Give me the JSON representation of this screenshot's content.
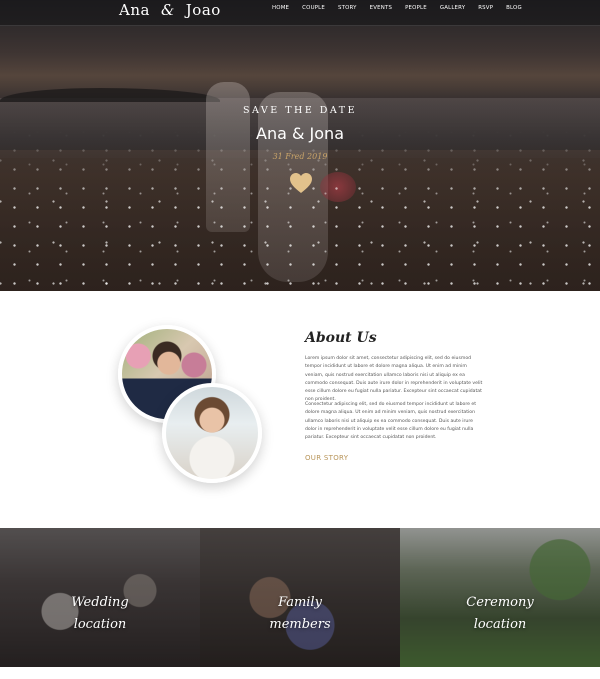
{
  "nav": {
    "logo_first": "Ana",
    "logo_amp": "&",
    "logo_second": "Joao",
    "links": [
      "HOME",
      "COUPLE",
      "STORY",
      "EVENTS",
      "PEOPLE",
      "GALLERY",
      "RSVP",
      "BLOG"
    ]
  },
  "hero": {
    "tagline": "SAVE THE DATE",
    "names": "Ana & Jona",
    "date": "31 Fred 2019",
    "icon": "heart-icon",
    "accent_color": "#c9a469"
  },
  "about": {
    "title": "About Us",
    "paragraph1": "Lorem ipsum dolor sit amet, consectetur adipiscing elit, sed do eiusmod tempor incididunt ut labore et dolore magna aliqua. Ut enim ad minim veniam, quis nostrud exercitation ullamco laboris nisi ut aliquip ex ea commodo consequat. Duis aute irure dolor in reprehenderit in voluptate velit esse cillum dolore eu fugiat nulla pariatur. Excepteur sint occaecat cupidatat non proident.",
    "paragraph2": "Consectetur adipiscing elit, sed do eiusmod tempor incididunt ut labore et dolore magna aliqua. Ut enim ad minim veniam, quis nostrud exercitation ullamco laboris nisi ut aliquip ex ea commodo consequat. Duis aute irure dolor in reprehenderit in voluptate velit esse cillum dolore eu fugiat nulla pariatur. Excepteur sint occaecat cupidatat non proident.",
    "link_label": "OUR STORY",
    "link_color": "#b8955a"
  },
  "tiles": [
    {
      "line1": "Wedding",
      "line2": "location"
    },
    {
      "line1": "Family",
      "line2": "members"
    },
    {
      "line1": "Ceremony",
      "line2": "location"
    }
  ]
}
